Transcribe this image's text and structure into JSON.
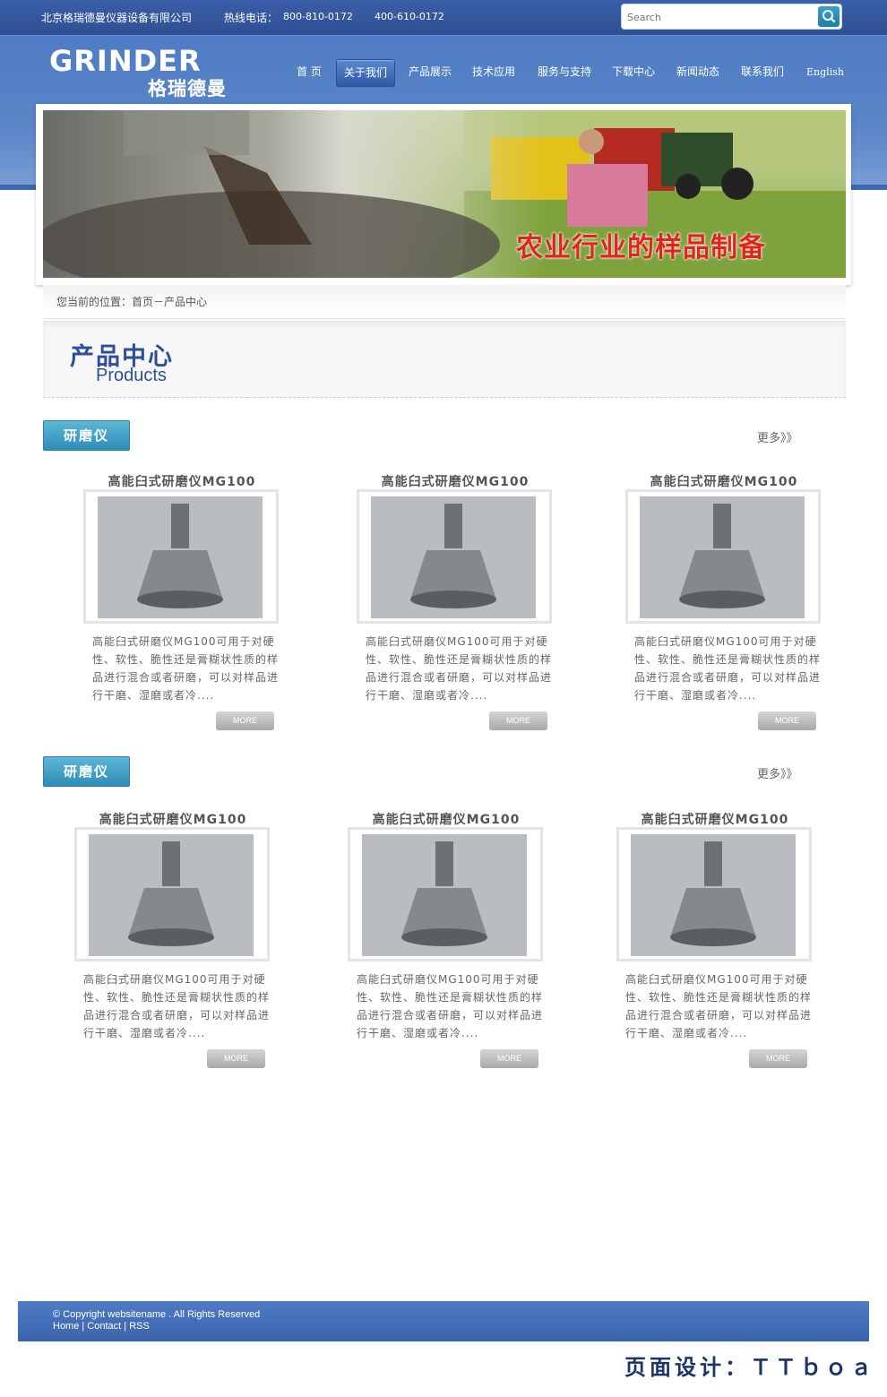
{
  "header": {
    "company": "北京格瑞德曼仪器设备有限公司",
    "hotline_label": "热线电话：",
    "phone1": "800-810-0172",
    "phone2": "400-610-0172",
    "search_placeholder": "Search",
    "logo_en": "GRINDER",
    "logo_cn": "格瑞德曼"
  },
  "nav": {
    "items": [
      "首 页",
      "关于我们",
      "产品展示",
      "技术应用",
      "服务与支持",
      "下载中心",
      "新闻动态",
      "联系我们",
      "English"
    ],
    "active": "关于我们"
  },
  "banner": {
    "slogan": "农业行业的样品制备"
  },
  "breadcrumb": "您当前的位置：首页－产品中心",
  "section_title": {
    "cn": "产品中心",
    "en": "Products"
  },
  "categories": [
    {
      "name": "研磨仪",
      "more": "更多》》",
      "products": [
        {
          "title": "高能臼式研磨仪MG100",
          "desc": "高能臼式研磨仪MG100可用于对硬性、软性、脆性还是膏糊状性质的样品进行混合或者研磨，可以对样品进行干磨、湿磨或者冷....",
          "more": "MORE"
        },
        {
          "title": "高能臼式研磨仪MG100",
          "desc": "高能臼式研磨仪MG100可用于对硬性、软性、脆性还是膏糊状性质的样品进行混合或者研磨，可以对样品进行干磨、湿磨或者冷....",
          "more": "MORE"
        },
        {
          "title": "高能臼式研磨仪MG100",
          "desc": "高能臼式研磨仪MG100可用于对硬性、软性、脆性还是膏糊状性质的样品进行混合或者研磨，可以对样品进行干磨、湿磨或者冷....",
          "more": "MORE"
        }
      ]
    },
    {
      "name": "研磨仪",
      "more": "更多》》",
      "products": [
        {
          "title": "高能臼式研磨仪MG100",
          "desc": "高能臼式研磨仪MG100可用于对硬性、软性、脆性还是膏糊状性质的样品进行混合或者研磨，可以对样品进行干磨、湿磨或者冷....",
          "more": "MORE"
        },
        {
          "title": "高能臼式研磨仪MG100",
          "desc": "高能臼式研磨仪MG100可用于对硬性、软性、脆性还是膏糊状性质的样品进行混合或者研磨，可以对样品进行干磨、湿磨或者冷....",
          "more": "MORE"
        },
        {
          "title": "高能臼式研磨仪MG100",
          "desc": "高能臼式研磨仪MG100可用于对硬性、软性、脆性还是膏糊状性质的样品进行混合或者研磨，可以对样品进行干磨、湿磨或者冷....",
          "more": "MORE"
        }
      ]
    }
  ],
  "footer": {
    "copyright": "© Copyright websitename . All Rights Reserved",
    "links": "Home | Contact | RSS"
  },
  "design_credit": "页面设计：ＴＴｂｏａ",
  "colors": {
    "brand_blue": "#3a63ad",
    "accent_teal": "#2d8db7",
    "title_blue": "#2d4f9a"
  }
}
